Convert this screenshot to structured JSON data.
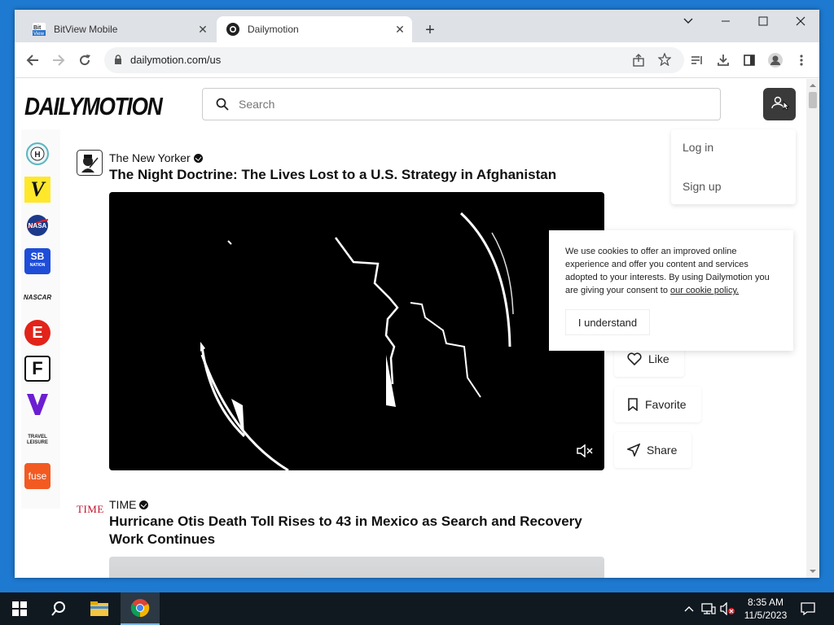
{
  "browser": {
    "tabs": [
      {
        "title": "BitView Mobile",
        "favicon": "bitview-icon"
      },
      {
        "title": "Dailymotion",
        "favicon": "dailymotion-icon",
        "active": true
      }
    ],
    "url": "dailymotion.com/us"
  },
  "page": {
    "logo": "DAILYMOTION",
    "search_placeholder": "Search",
    "menu": {
      "login": "Log in",
      "signup": "Sign up"
    },
    "channels": [
      "H",
      "V",
      "NASA",
      "SB NATION",
      "NASCAR",
      "E",
      "F",
      "V",
      "TRAVEL LEISURE",
      "fuse"
    ],
    "videos": [
      {
        "author": "The New Yorker",
        "title": "The Night Doctrine: The Lives Lost to a U.S. Strategy in Afghanistan"
      },
      {
        "author": "TIME",
        "author_logo": "TIME",
        "title_line1": "Hurricane Otis Death Toll Rises to 43 in Mexico as Search and Recovery",
        "title_line2": "Work Continues"
      }
    ],
    "actions": {
      "like": "Like",
      "favorite": "Favorite",
      "share": "Share"
    },
    "cookie": {
      "text": "We use cookies to offer an improved online experience and offer you content and services adopted to your interests. By using Dailymotion you are giving your consent to ",
      "link": "our cookie policy.",
      "button": "I understand"
    }
  },
  "taskbar": {
    "time": "8:35 AM",
    "date": "11/5/2023"
  },
  "colors": {
    "desktop": "#1e7ad0",
    "taskbar": "#101820",
    "tabstrip": "#dee1e6"
  }
}
